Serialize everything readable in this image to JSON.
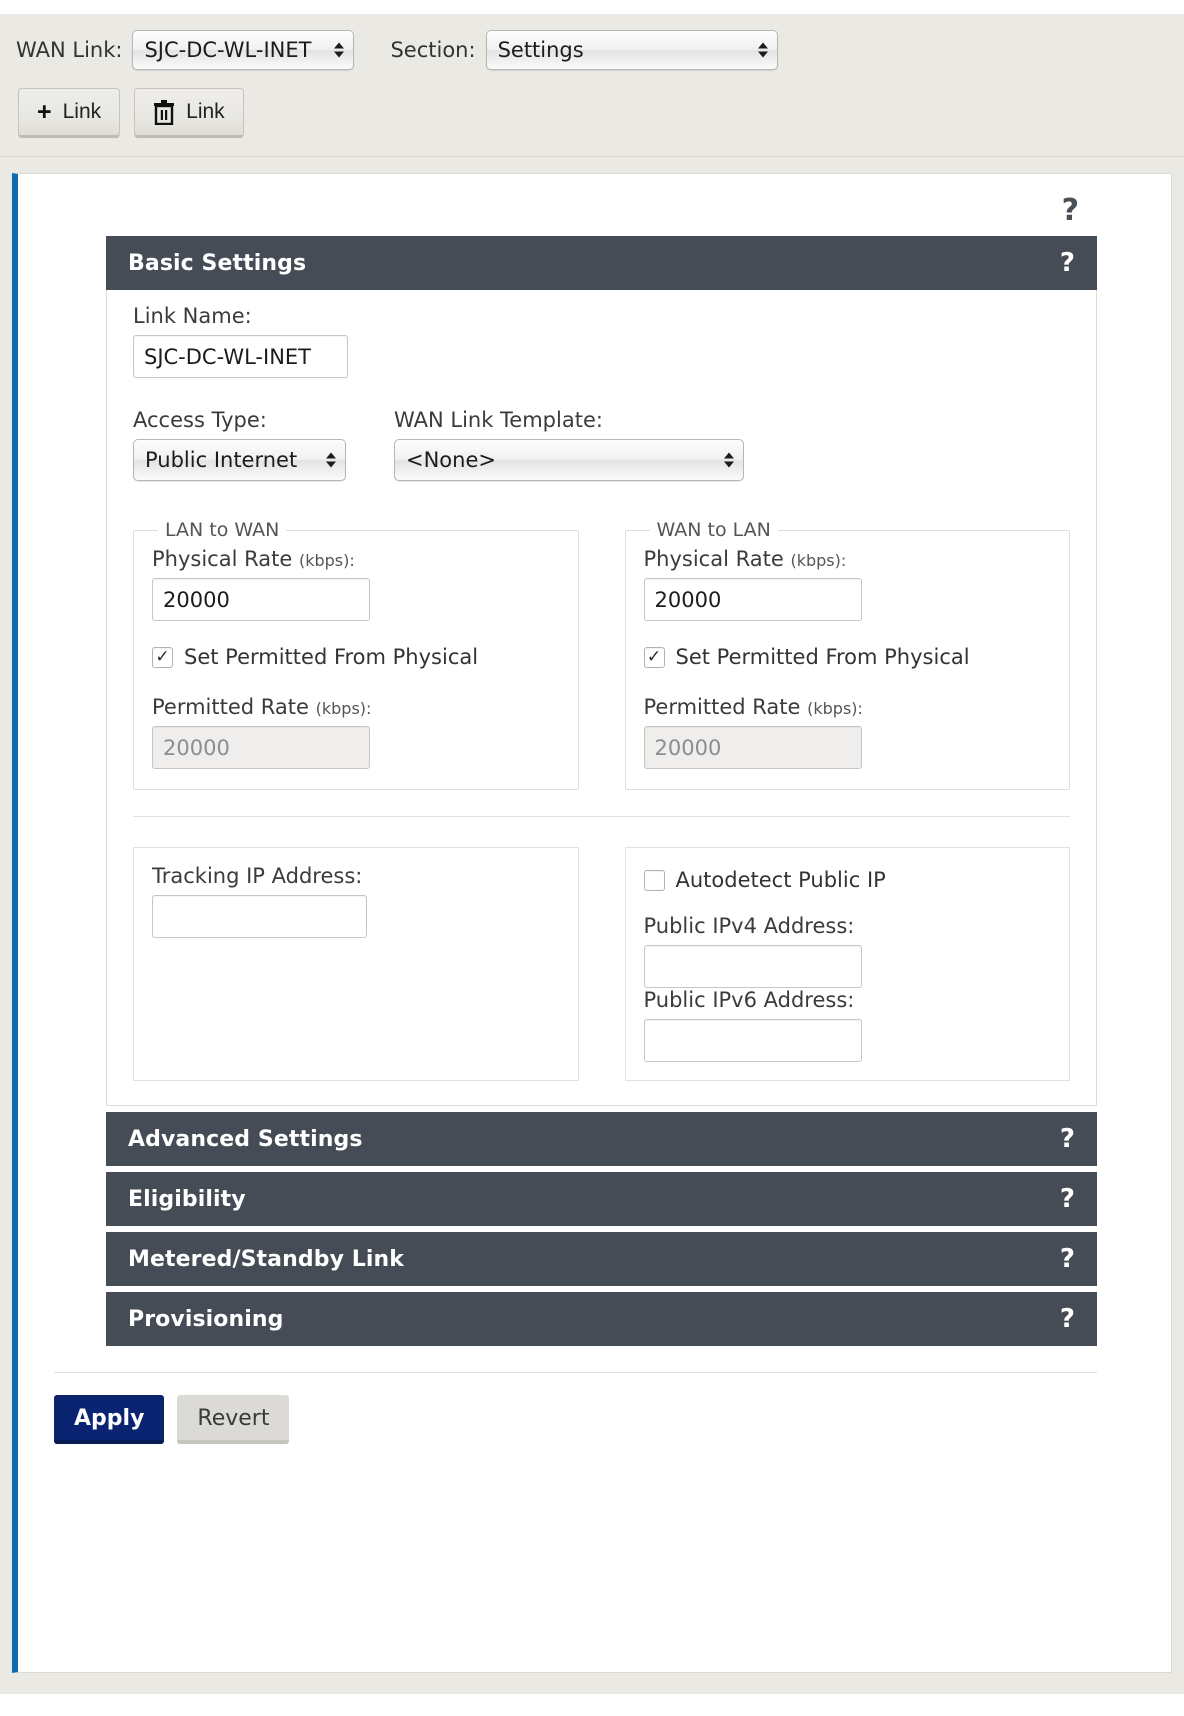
{
  "toolbar": {
    "wan_link_label": "WAN Link:",
    "wan_link_value": "SJC-DC-WL-INET",
    "section_label": "Section:",
    "section_value": "Settings",
    "add_link_label": "Link",
    "delete_link_label": "Link",
    "add_icon": "plus-icon",
    "delete_icon": "trash-icon"
  },
  "panel": {
    "help_glyph": "?"
  },
  "sections": {
    "basic": {
      "title": "Basic Settings",
      "help_glyph": "?",
      "link_name_label": "Link Name:",
      "link_name_value": "SJC-DC-WL-INET",
      "access_type_label": "Access Type:",
      "access_type_value": "Public Internet",
      "template_label": "WAN Link Template:",
      "template_value": "<None>",
      "lan_to_wan": {
        "legend": "LAN to WAN",
        "physical_rate_label": "Physical Rate",
        "physical_rate_unit": "(kbps):",
        "physical_rate_value": "20000",
        "checkbox_label": "Set Permitted From Physical",
        "checkbox_checked": "✓",
        "permitted_rate_label": "Permitted Rate",
        "permitted_rate_unit": "(kbps):",
        "permitted_rate_value": "20000"
      },
      "wan_to_lan": {
        "legend": "WAN to LAN",
        "physical_rate_label": "Physical Rate",
        "physical_rate_unit": "(kbps):",
        "physical_rate_value": "20000",
        "checkbox_label": "Set Permitted From Physical",
        "checkbox_checked": "✓",
        "permitted_rate_label": "Permitted Rate",
        "permitted_rate_unit": "(kbps):",
        "permitted_rate_value": "20000"
      },
      "tracking_ip_label": "Tracking IP Address:",
      "tracking_ip_value": "",
      "autodetect_label": "Autodetect Public IP",
      "autodetect_checked": "",
      "public_ipv4_label": "Public IPv4 Address:",
      "public_ipv4_value": "",
      "public_ipv6_label": "Public IPv6 Address:",
      "public_ipv6_value": ""
    },
    "collapsed": [
      {
        "title": "Advanced Settings",
        "help_glyph": "?"
      },
      {
        "title": "Eligibility",
        "help_glyph": "?"
      },
      {
        "title": "Metered/Standby Link",
        "help_glyph": "?"
      },
      {
        "title": "Provisioning",
        "help_glyph": "?"
      }
    ]
  },
  "footer": {
    "apply_label": "Apply",
    "revert_label": "Revert"
  },
  "colors": {
    "accent_bar": "#0d6cb4",
    "section_header": "#454c55",
    "apply_button": "#0b2472",
    "page_background": "#eae9e4"
  }
}
